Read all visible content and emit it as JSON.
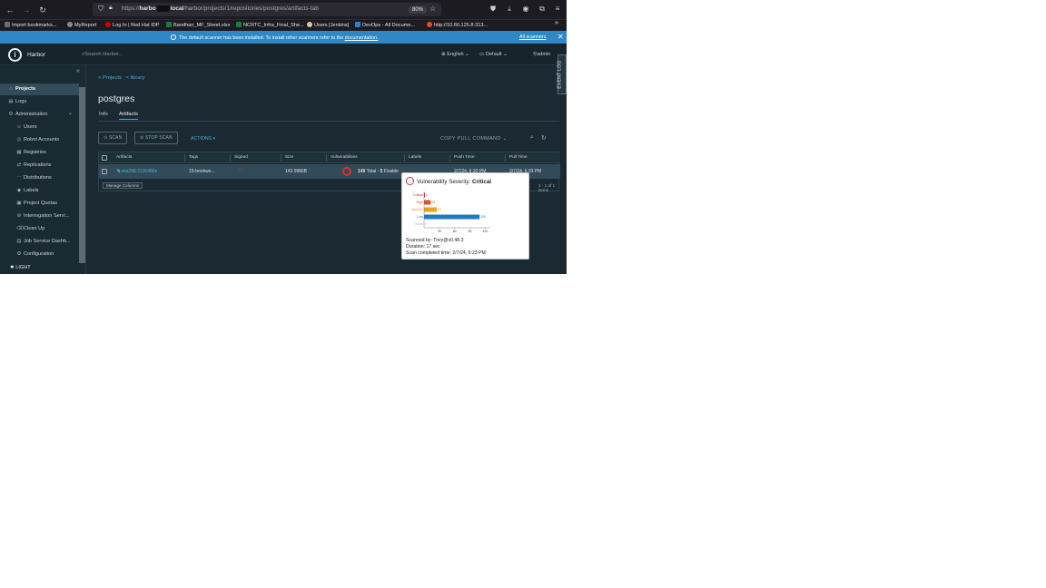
{
  "browser": {
    "url_prefix": "https://",
    "url_host_start": "harbo",
    "url_host_end": "local",
    "url_path": "/harbor/projects/1/repositories/postgres/artifacts-tab",
    "zoom": "80%",
    "bookmarks": [
      {
        "label": "Import bookmarks...",
        "color": "#6b6b78"
      },
      {
        "label": "MyReport",
        "color": "#8a8a96"
      },
      {
        "label": "Log In | Red Hat IDP",
        "color": "#cc0000"
      },
      {
        "label": "Bandhan_MF_Sheet.xlsx",
        "color": "#1f7a3f"
      },
      {
        "label": "NCRTC_Infra_Final_She...",
        "color": "#1f7a3f"
      },
      {
        "label": "Users [Jenkins]",
        "color": "#d9c9a3"
      },
      {
        "label": "DevOps - All Docume...",
        "color": "#2f7fd1"
      },
      {
        "label": "http://10.60.125.8:313...",
        "color": "#d94f2b"
      }
    ],
    "more": "»"
  },
  "banner": {
    "text": "The default scanner has been installed. To install other scanners refer to the",
    "link": "documentation.",
    "all_scanners": "All scanners",
    "close": "✕"
  },
  "header": {
    "app_name": "Harbor",
    "search_placeholder": "Search Harbor...",
    "language": "English",
    "theme": "Default",
    "user": "admin",
    "event_log": "EVENT LOG"
  },
  "sidebar": {
    "collapse": "«",
    "items": [
      {
        "label": "Projects",
        "icon": "projects-icon",
        "glyph": "⌂"
      },
      {
        "label": "Logs",
        "icon": "logs-icon",
        "glyph": "▤"
      },
      {
        "label": "Administration",
        "icon": "administration-icon",
        "glyph": "⚙",
        "chevron": "⌄"
      },
      {
        "label": "Users",
        "icon": "users-icon",
        "glyph": "☺"
      },
      {
        "label": "Robot Accounts",
        "icon": "robot-icon",
        "glyph": "◎"
      },
      {
        "label": "Registries",
        "icon": "registries-icon",
        "glyph": "▦"
      },
      {
        "label": "Replications",
        "icon": "replications-icon",
        "glyph": "⇄"
      },
      {
        "label": "Distributions",
        "icon": "distributions-icon",
        "glyph": "⋯"
      },
      {
        "label": "Labels",
        "icon": "labels-icon",
        "glyph": "◆"
      },
      {
        "label": "Project Quotas",
        "icon": "quotas-icon",
        "glyph": "▣"
      },
      {
        "label": "Interrogation Servi...",
        "icon": "interrogation-icon",
        "glyph": "⊛"
      },
      {
        "label": "Clean Up",
        "icon": "cleanup-icon",
        "glyph": "⌫"
      },
      {
        "label": "Job Service Dashb...",
        "icon": "job-service-icon",
        "glyph": "▥"
      },
      {
        "label": "Configuration",
        "icon": "configuration-icon",
        "glyph": "⚙"
      }
    ],
    "light": "LIGHT"
  },
  "main": {
    "crumb_projects": "< Projects",
    "crumb_library": "< library",
    "title": "postgres",
    "tabs": [
      "Info",
      "Artifacts"
    ],
    "scan_button": "SCAN",
    "stop_scan_button": "STOP SCAN",
    "actions": "ACTIONS",
    "copy_pull": "COPY PULL COMMAND",
    "columns": [
      "Artifacts",
      "Tags",
      "Signed",
      "Size",
      "Vulnerabilities",
      "Labels",
      "Push Time",
      "Pull Time"
    ],
    "row": {
      "artifact": "sha256:3136486e",
      "tags": "15-bookwo...",
      "size": "143.99MiB",
      "vuln_total_count": "149",
      "vuln_total_label": "Total",
      "vuln_sep": "·",
      "vuln_fixable_count": "5",
      "vuln_fixable_label": "Fixable",
      "push_time": "2/7/24, 6:20 PM",
      "pull_time": "2/7/24, 6:33 PM"
    },
    "manage_columns": "Manage Columns",
    "pager": "1 - 1 of 1 items"
  },
  "popover": {
    "heading": "Vulnerability Severity:",
    "severity": "Critical",
    "scanned_by": "Scanned by: Trivy@v0.48.3",
    "duration": "Duration: 17 sec",
    "completed": "Scan completed time: 2/7/24, 6:23 PM"
  },
  "chart_data": {
    "type": "bar",
    "orientation": "horizontal",
    "categories": [
      "Critical",
      "High",
      "Medium",
      "Low",
      "None"
    ],
    "values": [
      2,
      13,
      25,
      109,
      0
    ],
    "colors": [
      "#e12b2b",
      "#e0532b",
      "#f0a020",
      "#1f7bc0",
      "#aaaaaa"
    ],
    "xlim": [
      0,
      130
    ],
    "xticks": [
      30,
      60,
      90,
      120
    ]
  }
}
